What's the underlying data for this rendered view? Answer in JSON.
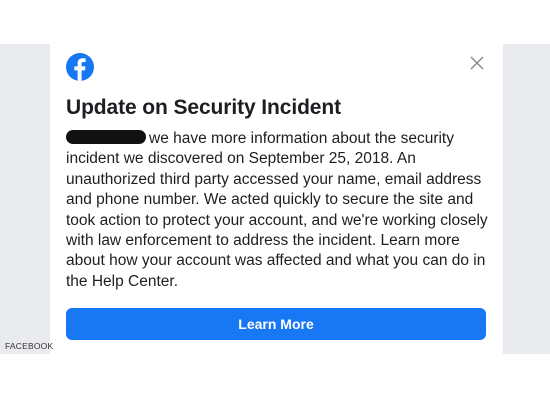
{
  "dialog": {
    "title": "Update on Security Incident",
    "body_text": "we have more information about the security incident we discovered on September 25, 2018. An unauthorized third party accessed your name, email address and phone number. We acted quickly to secure the site and took action to protect your account, and we're working closely with law enforcement to address the incident. Learn more about how your account was affected and what you can do in the Help Center.",
    "button_label": "Learn More"
  },
  "photo_credit": "FACEBOOK",
  "icons": {
    "logo": "facebook-logo-icon",
    "close": "close-icon"
  },
  "colors": {
    "brand_blue": "#1877f2",
    "text": "#1c1e21",
    "side_gray": "#e9ebee",
    "redaction": "#111111"
  }
}
